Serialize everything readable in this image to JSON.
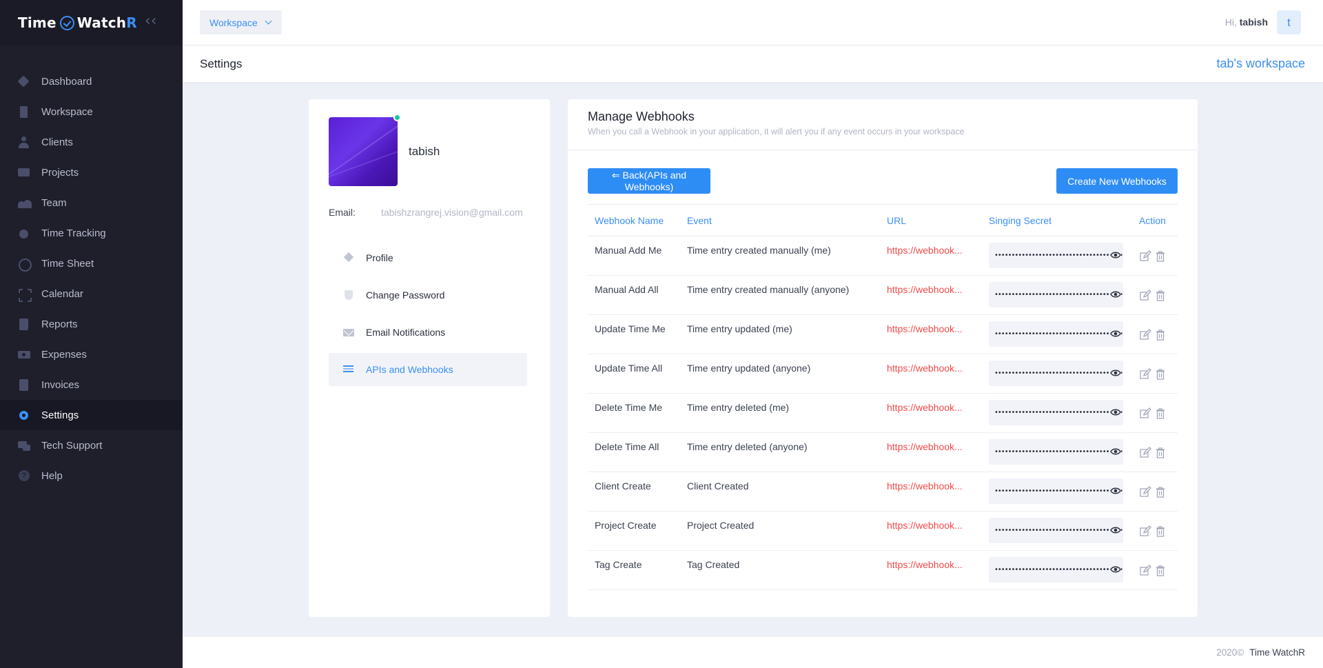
{
  "brand": {
    "name_part1": "Time",
    "name_part2": "Watch",
    "name_part3": "R"
  },
  "sidebar": {
    "items": [
      {
        "label": "Dashboard",
        "icon": "dashboard-icon"
      },
      {
        "label": "Workspace",
        "icon": "workspace-icon"
      },
      {
        "label": "Clients",
        "icon": "clients-icon"
      },
      {
        "label": "Projects",
        "icon": "projects-icon"
      },
      {
        "label": "Team",
        "icon": "team-icon"
      },
      {
        "label": "Time Tracking",
        "icon": "time-tracking-icon"
      },
      {
        "label": "Time Sheet",
        "icon": "time-sheet-icon"
      },
      {
        "label": "Calendar",
        "icon": "calendar-icon"
      },
      {
        "label": "Reports",
        "icon": "reports-icon"
      },
      {
        "label": "Expenses",
        "icon": "expenses-icon"
      },
      {
        "label": "Invoices",
        "icon": "invoices-icon"
      },
      {
        "label": "Settings",
        "icon": "settings-icon",
        "active": true
      },
      {
        "label": "Tech Support",
        "icon": "tech-support-icon"
      },
      {
        "label": "Help",
        "icon": "help-icon"
      }
    ]
  },
  "header": {
    "workspace_dropdown": "Workspace",
    "greeting_prefix": "Hi,",
    "user_name": "tabish",
    "avatar_letter": "t"
  },
  "subheader": {
    "title": "Settings",
    "workspace_name": "tab's workspace"
  },
  "profile": {
    "name": "tabish",
    "email_label": "Email:",
    "email": "tabishzrangrej.vision@gmail.com",
    "menu": [
      {
        "label": "Profile",
        "icon": "profile-icon"
      },
      {
        "label": "Change Password",
        "icon": "shield-icon"
      },
      {
        "label": "Email Notifications",
        "icon": "mail-icon"
      },
      {
        "label": "APIs and Webhooks",
        "icon": "list-icon",
        "active": true
      }
    ]
  },
  "webhooks": {
    "title": "Manage Webhooks",
    "subtitle": "When you call a Webhook in your application, it will alert you if any event occurs in your workspace",
    "back_button": "⇐ Back(APIs and Webhooks)",
    "create_button": "Create New Webhooks",
    "columns": [
      "Webhook Name",
      "Event",
      "URL",
      "Singing Secret",
      "Action"
    ],
    "rows": [
      {
        "name": "Manual Add Me",
        "event": "Time entry created manually (me)",
        "url": "https://webhook...",
        "secret": "••••••••••••••••••••••••••••••••••••••••"
      },
      {
        "name": "Manual Add All",
        "event": "Time entry created manually (anyone)",
        "url": "https://webhook...",
        "secret": "••••••••••••••••••••••••••••••••••••••••"
      },
      {
        "name": "Update Time Me",
        "event": "Time entry updated (me)",
        "url": "https://webhook...",
        "secret": "••••••••••••••••••••••••••••••••••••••••"
      },
      {
        "name": "Update Time All",
        "event": "Time entry updated (anyone)",
        "url": "https://webhook...",
        "secret": "••••••••••••••••••••••••••••••••••••••••"
      },
      {
        "name": "Delete Time Me",
        "event": "Time entry deleted (me)",
        "url": "https://webhook...",
        "secret": "••••••••••••••••••••••••••••••••••••••••"
      },
      {
        "name": "Delete Time All",
        "event": "Time entry deleted (anyone)",
        "url": "https://webhook...",
        "secret": "••••••••••••••••••••••••••••••••••••••••"
      },
      {
        "name": "Client Create",
        "event": "Client Created",
        "url": "https://webhook...",
        "secret": "••••••••••••••••••••••••••••••••••••••••"
      },
      {
        "name": "Project Create",
        "event": "Project Created",
        "url": "https://webhook...",
        "secret": "••••••••••••••••••••••••••••••••••••••••"
      },
      {
        "name": "Tag Create",
        "event": "Tag Created",
        "url": "https://webhook...",
        "secret": "••••••••••••••••••••••••••••••••••••••••"
      }
    ]
  },
  "footer": {
    "year": "2020©",
    "brand": "Time WatchR"
  },
  "colors": {
    "accent": "#3b8ff4",
    "sidebar_bg": "#1f1f2c",
    "url_red": "#f04a4a",
    "online": "#16c7a0"
  }
}
